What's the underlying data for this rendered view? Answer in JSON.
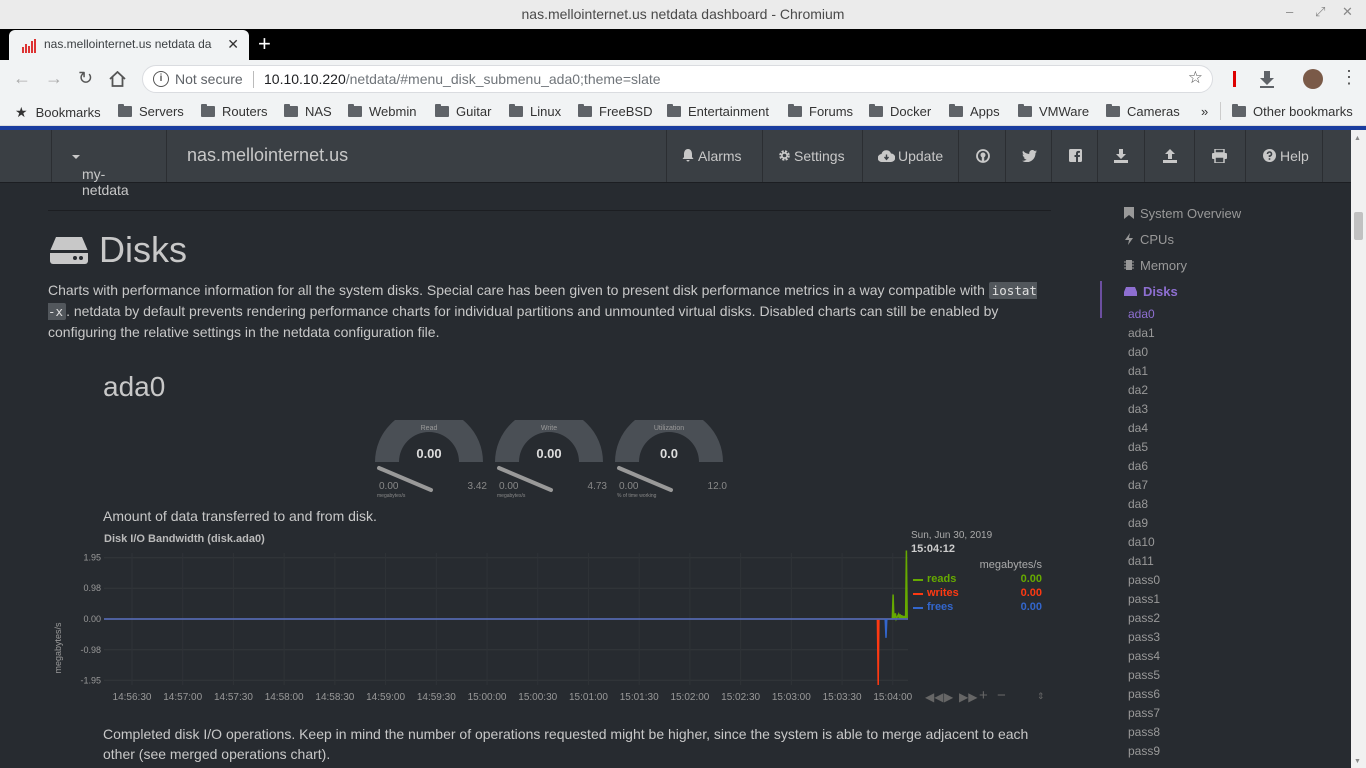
{
  "window": {
    "title": "nas.mellointernet.us netdata dashboard - Chromium"
  },
  "tab": {
    "title": "nas.mellointernet.us netdata da",
    "close": "✕",
    "new_tab": "+"
  },
  "address": {
    "security": "Not secure",
    "host": "10.10.10.220",
    "path": "/netdata/#menu_disk_submenu_ada0;theme=slate"
  },
  "bookmarks": {
    "items": [
      "Bookmarks",
      "Servers",
      "Routers",
      "NAS",
      "Webmin",
      "Guitar",
      "Linux",
      "FreeBSD",
      "Entertainment",
      "Forums",
      "Docker",
      "Apps",
      "VMWare",
      "Cameras"
    ],
    "overflow": "»",
    "other": "Other bookmarks"
  },
  "netdata": {
    "brand": "my-netdata",
    "hostname": "nas.mellointernet.us",
    "nav": {
      "alarms": "Alarms",
      "settings": "Settings",
      "update": "Update",
      "help": "Help"
    }
  },
  "section": {
    "title": "Disks",
    "desc_part1": "Charts with performance information for all the system disks. Special care has been given to present disk performance metrics in a way compatible with ",
    "code": "iostat -x",
    "desc_part2": ". netdata by default prevents rendering performance charts for individual partitions and unmounted virtual disks. Disabled charts can still be enabled by configuring the relative settings in the netdata configuration file."
  },
  "submenu": {
    "title": "ada0"
  },
  "gauges": [
    {
      "label": "Read",
      "value": "0.00",
      "min": "0.00",
      "max": "3.42",
      "unit": "megabytes/s"
    },
    {
      "label": "Write",
      "value": "0.00",
      "min": "0.00",
      "max": "4.73",
      "unit": "megabytes/s"
    },
    {
      "label": "Utilization",
      "value": "0.0",
      "min": "0.00",
      "max": "12.0",
      "unit": "% of time working"
    }
  ],
  "chart": {
    "description": "Amount of data transferred to and from disk.",
    "title": "Disk I/O Bandwidth (disk.ada0)",
    "ylabel": "megabytes/s",
    "legend": {
      "date": "Sun, Jun 30, 2019",
      "time": "15:04:12",
      "units": "megabytes/s",
      "rows": [
        {
          "name": "reads",
          "value": "0.00",
          "color": "#66aa00"
        },
        {
          "name": "writes",
          "value": "0.00",
          "color": "#fe3912"
        },
        {
          "name": "frees",
          "value": "0.00",
          "color": "#3366cc"
        }
      ]
    }
  },
  "chart_data": {
    "type": "line",
    "title": "Disk I/O Bandwidth (disk.ada0)",
    "ylabel": "megabytes/s",
    "ylim": [
      -2.1,
      2.1
    ],
    "y_ticks": [
      "1.95",
      "0.98",
      "0.00",
      "-0.98",
      "-1.95"
    ],
    "x_ticks": [
      "14:56:30",
      "14:57:00",
      "14:57:30",
      "14:58:00",
      "14:58:30",
      "14:59:00",
      "14:59:30",
      "15:00:00",
      "15:00:30",
      "15:01:00",
      "15:01:30",
      "15:02:00",
      "15:02:30",
      "15:03:00",
      "15:03:30",
      "15:04:00"
    ],
    "grid": true,
    "legend_position": "right",
    "series": [
      {
        "name": "reads",
        "color": "#66aa00",
        "points": [
          [
            0,
            0
          ],
          [
            1004,
            0
          ],
          [
            1005,
            0.78
          ],
          [
            1006,
            0
          ],
          [
            1008,
            0.18
          ],
          [
            1009,
            0
          ],
          [
            1012,
            0.15
          ],
          [
            1013,
            0
          ],
          [
            1014,
            0.15
          ],
          [
            1015,
            0
          ],
          [
            1016,
            0.12
          ],
          [
            1017,
            0
          ],
          [
            1018,
            0.1
          ],
          [
            1019,
            0
          ],
          [
            1020,
            0.1
          ],
          [
            1021,
            0
          ],
          [
            1022,
            2.18
          ],
          [
            1023,
            0
          ],
          [
            1024,
            0
          ]
        ]
      },
      {
        "name": "writes",
        "color": "#fe3912",
        "points": [
          [
            0,
            0
          ],
          [
            985,
            0
          ],
          [
            986,
            -2.1
          ],
          [
            987,
            0
          ],
          [
            1024,
            0
          ]
        ]
      },
      {
        "name": "frees",
        "color": "#3366cc",
        "points": [
          [
            0,
            0
          ],
          [
            995,
            0
          ],
          [
            996,
            -0.6
          ],
          [
            997,
            0
          ],
          [
            1024,
            0
          ]
        ]
      }
    ]
  },
  "chart2": {
    "description": "Completed disk I/O operations. Keep in mind the number of operations requested might be higher, since the system is able to merge adjacent to each other (see merged operations chart)."
  },
  "sidebar": {
    "top_items": [
      "System Overview",
      "CPUs",
      "Memory",
      "Disks"
    ],
    "disk_items": [
      "ada0",
      "ada1",
      "da0",
      "da1",
      "da2",
      "da3",
      "da4",
      "da5",
      "da6",
      "da7",
      "da8",
      "da9",
      "da10",
      "da11",
      "pass0",
      "pass1",
      "pass2",
      "pass3",
      "pass4",
      "pass5",
      "pass6",
      "pass7",
      "pass8",
      "pass9"
    ]
  }
}
